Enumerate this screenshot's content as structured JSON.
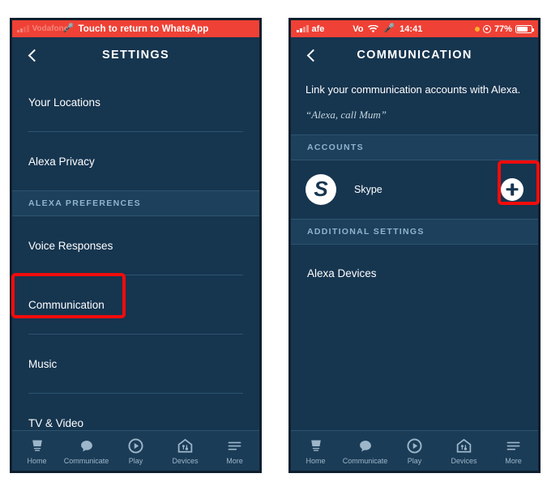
{
  "left_phone": {
    "status_bar": {
      "banner_text": "Touch to return to WhatsApp",
      "mic_icon": "microphone-icon",
      "banner_color": "#ef4135"
    },
    "nav": {
      "back_icon": "back-chevron-icon",
      "title": "SETTINGS"
    },
    "menu_items": [
      {
        "label": "Your Locations"
      },
      {
        "label": "Alexa Privacy"
      }
    ],
    "section_label": "ALEXA PREFERENCES",
    "pref_items": [
      {
        "label": "Voice Responses"
      },
      {
        "label": "Communication",
        "highlighted": true
      },
      {
        "label": "Music"
      },
      {
        "label": "TV & Video"
      }
    ],
    "tabs": [
      {
        "label": "Home",
        "icon": "echo-speaker-icon"
      },
      {
        "label": "Communicate",
        "icon": "speech-bubble-icon"
      },
      {
        "label": "Play",
        "icon": "play-circle-icon"
      },
      {
        "label": "Devices",
        "icon": "home-devices-icon"
      },
      {
        "label": "More",
        "icon": "hamburger-menu-icon"
      }
    ]
  },
  "right_phone": {
    "status_bar": {
      "carrier": "afe",
      "network": "Vo",
      "time": "14:41",
      "battery_percent": "77%",
      "signal_icon": "signal-bars-icon",
      "wifi_icon": "wifi-icon",
      "mic_icon": "microphone-icon",
      "alarm_icon": "alarm-icon",
      "battery_icon": "battery-icon",
      "bar_color": "#ef4135"
    },
    "nav": {
      "back_icon": "back-chevron-icon",
      "title": "COMMUNICATION"
    },
    "subtitle": "Link your communication accounts with Alexa.",
    "quote": "“Alexa, call Mum”",
    "accounts_section_label": "ACCOUNTS",
    "accounts": [
      {
        "name": "Skype",
        "badge": "S",
        "action_icon": "plus-button",
        "highlighted": true
      }
    ],
    "additional_section_label": "ADDITIONAL SETTINGS",
    "additional_items": [
      {
        "label": "Alexa Devices"
      }
    ],
    "tabs": [
      {
        "label": "Home",
        "icon": "echo-speaker-icon"
      },
      {
        "label": "Communicate",
        "icon": "speech-bubble-icon"
      },
      {
        "label": "Play",
        "icon": "play-circle-icon"
      },
      {
        "label": "Devices",
        "icon": "home-devices-icon"
      },
      {
        "label": "More",
        "icon": "hamburger-menu-icon"
      }
    ]
  },
  "annotation": {
    "color": "#f50b0b",
    "targets": [
      "Communication",
      "Skype add button"
    ]
  },
  "theme": {
    "background": "#16354f",
    "section_band": "#1d415c",
    "divider": "#2d5470",
    "accent_red": "#ef4135",
    "tab_inactive": "#9db6c9"
  }
}
